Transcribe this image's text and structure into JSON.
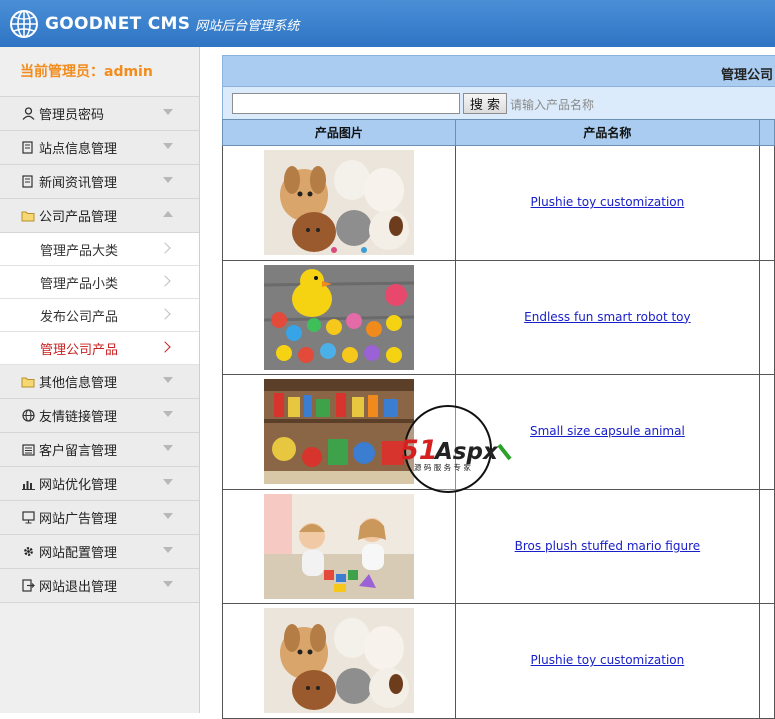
{
  "header": {
    "brand": "GOODNET CMS",
    "subtitle": "网站后台管理系统"
  },
  "sidebar": {
    "admin_label": "当前管理员：admin",
    "items": [
      {
        "label": "管理员密码",
        "icon": "user-icon"
      },
      {
        "label": "站点信息管理",
        "icon": "edit-icon"
      },
      {
        "label": "新闻资讯管理",
        "icon": "edit-icon"
      },
      {
        "label": "公司产品管理",
        "icon": "folder-icon",
        "expanded": true,
        "children": [
          {
            "label": "管理产品大类"
          },
          {
            "label": "管理产品小类"
          },
          {
            "label": "发布公司产品"
          },
          {
            "label": "管理公司产品",
            "active": true
          }
        ]
      },
      {
        "label": "其他信息管理",
        "icon": "folder-icon"
      },
      {
        "label": "友情链接管理",
        "icon": "globe-icon"
      },
      {
        "label": "客户留言管理",
        "icon": "list-icon"
      },
      {
        "label": "网站优化管理",
        "icon": "bar-chart-icon"
      },
      {
        "label": "网站广告管理",
        "icon": "monitor-icon"
      },
      {
        "label": "网站配置管理",
        "icon": "gear-icon"
      },
      {
        "label": "网站退出管理",
        "icon": "exit-icon"
      }
    ]
  },
  "main": {
    "title": "管理公司",
    "search": {
      "value": "",
      "placeholder": "",
      "button": "搜 索",
      "hint": "请输入产品名称"
    },
    "table": {
      "headers": [
        "产品图片",
        "产品名称",
        ""
      ],
      "rows": [
        {
          "name": "Plushie toy customization",
          "image": "plush-toys"
        },
        {
          "name": "Endless fun smart robot toy",
          "image": "rubber-ducks"
        },
        {
          "name": "Small size capsule animal",
          "image": "toy-shop"
        },
        {
          "name": "Bros plush stuffed mario figure",
          "image": "kids-playing"
        },
        {
          "name": "Plushie toy customization",
          "image": "plush-toys"
        }
      ]
    }
  },
  "watermark": {
    "text": "51Aspx",
    "caption": "源码服务专家"
  },
  "colors": {
    "header": "#2f74c4",
    "admin": "#f28c1c",
    "active": "#c91f1f",
    "table_header": "#a9ccf0",
    "link": "#1a20c9"
  }
}
